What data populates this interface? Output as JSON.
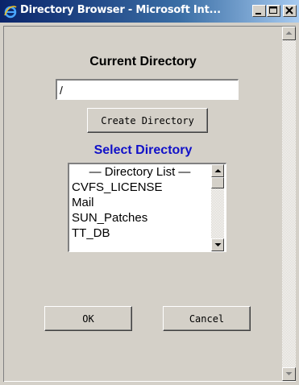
{
  "window": {
    "title": "Directory Browser - Microsoft Int...",
    "icon": "ie-logo-icon",
    "controls": [
      "minimize-icon",
      "maximize-icon",
      "close-icon"
    ]
  },
  "form": {
    "current_heading": "Current Directory",
    "current_value": "/",
    "create_label": "Create Directory",
    "select_heading": "Select Directory",
    "list": {
      "header": "— Directory List —",
      "items": [
        "CVFS_LICENSE",
        "Mail",
        "SUN_Patches",
        "TT_DB"
      ]
    },
    "ok_label": "OK",
    "cancel_label": "Cancel"
  },
  "colors": {
    "titlebar_start": "#0a246a",
    "titlebar_end": "#a6caf0",
    "face": "#d4d0c8",
    "select_heading": "#1010c8"
  }
}
